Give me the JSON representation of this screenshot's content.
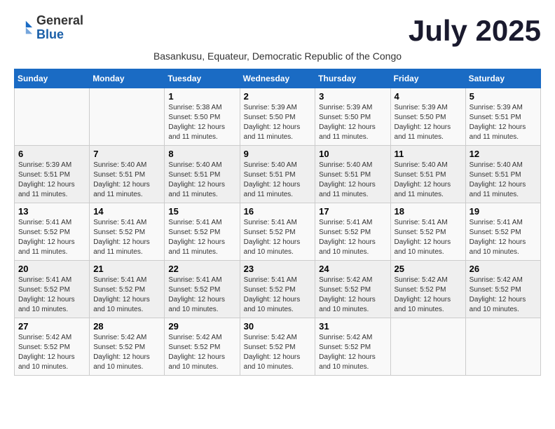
{
  "header": {
    "logo_line1": "General",
    "logo_line2": "Blue",
    "month_title": "July 2025",
    "subtitle": "Basankusu, Equateur, Democratic Republic of the Congo"
  },
  "weekdays": [
    "Sunday",
    "Monday",
    "Tuesday",
    "Wednesday",
    "Thursday",
    "Friday",
    "Saturday"
  ],
  "weeks": [
    [
      {
        "day": "",
        "info": ""
      },
      {
        "day": "",
        "info": ""
      },
      {
        "day": "1",
        "info": "Sunrise: 5:38 AM\nSunset: 5:50 PM\nDaylight: 12 hours and 11 minutes."
      },
      {
        "day": "2",
        "info": "Sunrise: 5:39 AM\nSunset: 5:50 PM\nDaylight: 12 hours and 11 minutes."
      },
      {
        "day": "3",
        "info": "Sunrise: 5:39 AM\nSunset: 5:50 PM\nDaylight: 12 hours and 11 minutes."
      },
      {
        "day": "4",
        "info": "Sunrise: 5:39 AM\nSunset: 5:50 PM\nDaylight: 12 hours and 11 minutes."
      },
      {
        "day": "5",
        "info": "Sunrise: 5:39 AM\nSunset: 5:51 PM\nDaylight: 12 hours and 11 minutes."
      }
    ],
    [
      {
        "day": "6",
        "info": "Sunrise: 5:39 AM\nSunset: 5:51 PM\nDaylight: 12 hours and 11 minutes."
      },
      {
        "day": "7",
        "info": "Sunrise: 5:40 AM\nSunset: 5:51 PM\nDaylight: 12 hours and 11 minutes."
      },
      {
        "day": "8",
        "info": "Sunrise: 5:40 AM\nSunset: 5:51 PM\nDaylight: 12 hours and 11 minutes."
      },
      {
        "day": "9",
        "info": "Sunrise: 5:40 AM\nSunset: 5:51 PM\nDaylight: 12 hours and 11 minutes."
      },
      {
        "day": "10",
        "info": "Sunrise: 5:40 AM\nSunset: 5:51 PM\nDaylight: 12 hours and 11 minutes."
      },
      {
        "day": "11",
        "info": "Sunrise: 5:40 AM\nSunset: 5:51 PM\nDaylight: 12 hours and 11 minutes."
      },
      {
        "day": "12",
        "info": "Sunrise: 5:40 AM\nSunset: 5:51 PM\nDaylight: 12 hours and 11 minutes."
      }
    ],
    [
      {
        "day": "13",
        "info": "Sunrise: 5:41 AM\nSunset: 5:52 PM\nDaylight: 12 hours and 11 minutes."
      },
      {
        "day": "14",
        "info": "Sunrise: 5:41 AM\nSunset: 5:52 PM\nDaylight: 12 hours and 11 minutes."
      },
      {
        "day": "15",
        "info": "Sunrise: 5:41 AM\nSunset: 5:52 PM\nDaylight: 12 hours and 11 minutes."
      },
      {
        "day": "16",
        "info": "Sunrise: 5:41 AM\nSunset: 5:52 PM\nDaylight: 12 hours and 10 minutes."
      },
      {
        "day": "17",
        "info": "Sunrise: 5:41 AM\nSunset: 5:52 PM\nDaylight: 12 hours and 10 minutes."
      },
      {
        "day": "18",
        "info": "Sunrise: 5:41 AM\nSunset: 5:52 PM\nDaylight: 12 hours and 10 minutes."
      },
      {
        "day": "19",
        "info": "Sunrise: 5:41 AM\nSunset: 5:52 PM\nDaylight: 12 hours and 10 minutes."
      }
    ],
    [
      {
        "day": "20",
        "info": "Sunrise: 5:41 AM\nSunset: 5:52 PM\nDaylight: 12 hours and 10 minutes."
      },
      {
        "day": "21",
        "info": "Sunrise: 5:41 AM\nSunset: 5:52 PM\nDaylight: 12 hours and 10 minutes."
      },
      {
        "day": "22",
        "info": "Sunrise: 5:41 AM\nSunset: 5:52 PM\nDaylight: 12 hours and 10 minutes."
      },
      {
        "day": "23",
        "info": "Sunrise: 5:41 AM\nSunset: 5:52 PM\nDaylight: 12 hours and 10 minutes."
      },
      {
        "day": "24",
        "info": "Sunrise: 5:42 AM\nSunset: 5:52 PM\nDaylight: 12 hours and 10 minutes."
      },
      {
        "day": "25",
        "info": "Sunrise: 5:42 AM\nSunset: 5:52 PM\nDaylight: 12 hours and 10 minutes."
      },
      {
        "day": "26",
        "info": "Sunrise: 5:42 AM\nSunset: 5:52 PM\nDaylight: 12 hours and 10 minutes."
      }
    ],
    [
      {
        "day": "27",
        "info": "Sunrise: 5:42 AM\nSunset: 5:52 PM\nDaylight: 12 hours and 10 minutes."
      },
      {
        "day": "28",
        "info": "Sunrise: 5:42 AM\nSunset: 5:52 PM\nDaylight: 12 hours and 10 minutes."
      },
      {
        "day": "29",
        "info": "Sunrise: 5:42 AM\nSunset: 5:52 PM\nDaylight: 12 hours and 10 minutes."
      },
      {
        "day": "30",
        "info": "Sunrise: 5:42 AM\nSunset: 5:52 PM\nDaylight: 12 hours and 10 minutes."
      },
      {
        "day": "31",
        "info": "Sunrise: 5:42 AM\nSunset: 5:52 PM\nDaylight: 12 hours and 10 minutes."
      },
      {
        "day": "",
        "info": ""
      },
      {
        "day": "",
        "info": ""
      }
    ]
  ]
}
